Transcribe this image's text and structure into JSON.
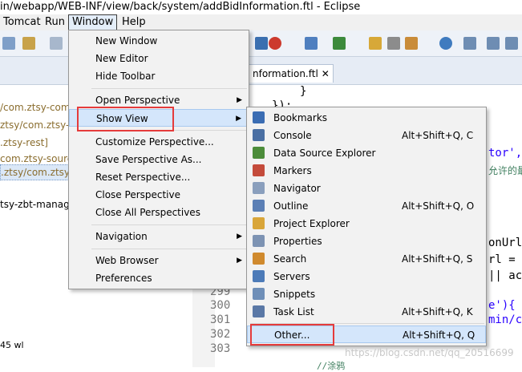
{
  "window": {
    "title": "in/webapp/WEB-INF/view/back/system/addBidInformation.ftl - Eclipse"
  },
  "menubar": {
    "items": [
      {
        "label": "Tomcat"
      },
      {
        "label": "Run"
      },
      {
        "label": "Window"
      },
      {
        "label": "Help"
      }
    ]
  },
  "window_menu": {
    "items": [
      {
        "label": "New Window",
        "submenu": false
      },
      {
        "label": "New Editor",
        "submenu": false
      },
      {
        "label": "Hide Toolbar",
        "submenu": false
      },
      {
        "label": "Open Perspective",
        "submenu": true
      },
      {
        "label": "Show View",
        "submenu": true,
        "highlighted": true
      },
      {
        "label": "Customize Perspective...",
        "submenu": false
      },
      {
        "label": "Save Perspective As...",
        "submenu": false
      },
      {
        "label": "Reset Perspective...",
        "submenu": false
      },
      {
        "label": "Close Perspective",
        "submenu": false
      },
      {
        "label": "Close All Perspectives",
        "submenu": false
      },
      {
        "label": "Navigation",
        "submenu": true
      },
      {
        "label": "Web Browser",
        "submenu": true
      },
      {
        "label": "Preferences",
        "submenu": false
      }
    ]
  },
  "show_view_menu": {
    "items": [
      {
        "label": "Bookmarks",
        "shortcut": "",
        "icon": "bookmark-icon"
      },
      {
        "label": "Console",
        "shortcut": "Alt+Shift+Q, C",
        "icon": "console-icon"
      },
      {
        "label": "Data Source Explorer",
        "shortcut": "",
        "icon": "data-source-icon"
      },
      {
        "label": "Markers",
        "shortcut": "",
        "icon": "markers-icon"
      },
      {
        "label": "Navigator",
        "shortcut": "",
        "icon": "navigator-icon"
      },
      {
        "label": "Outline",
        "shortcut": "Alt+Shift+Q, O",
        "icon": "outline-icon"
      },
      {
        "label": "Project Explorer",
        "shortcut": "",
        "icon": "project-explorer-icon"
      },
      {
        "label": "Properties",
        "shortcut": "",
        "icon": "properties-icon"
      },
      {
        "label": "Search",
        "shortcut": "Alt+Shift+Q, S",
        "icon": "search-icon"
      },
      {
        "label": "Servers",
        "shortcut": "",
        "icon": "servers-icon"
      },
      {
        "label": "Snippets",
        "shortcut": "",
        "icon": "snippets-icon"
      },
      {
        "label": "Task List",
        "shortcut": "Alt+Shift+Q, K",
        "icon": "task-list-icon"
      },
      {
        "label": "Other...",
        "shortcut": "Alt+Shift+Q, Q",
        "icon": ""
      }
    ]
  },
  "left_pane": {
    "rows": [
      {
        "text": "/com.ztsy-com"
      },
      {
        "text": "ztsy/com.ztsy-c"
      },
      {
        "text": ".ztsy-rest]"
      },
      {
        "text": "com.ztsy-source"
      },
      {
        "text": ".ztsy/com.ztsy-"
      },
      {
        "text": "tsy-zbt-manag"
      }
    ],
    "status": "45 wl"
  },
  "editor": {
    "tab_label": "nformation.ftl",
    "line_numbers": [
      "299",
      "300",
      "301",
      "302",
      "303"
    ],
    "code_fragments": [
      "}",
      "});",
      "tor',",
      "允许的最大",
      "onUrl",
      "rl =",
      "|| ac",
      "e'){",
      "min/c",
      "//涂鸦"
    ]
  },
  "watermark": "https://blog.csdn.net/qq_20516699",
  "colors": {
    "highlight_border": "#e53b3b",
    "menu_hover": "#d4e6fb"
  }
}
